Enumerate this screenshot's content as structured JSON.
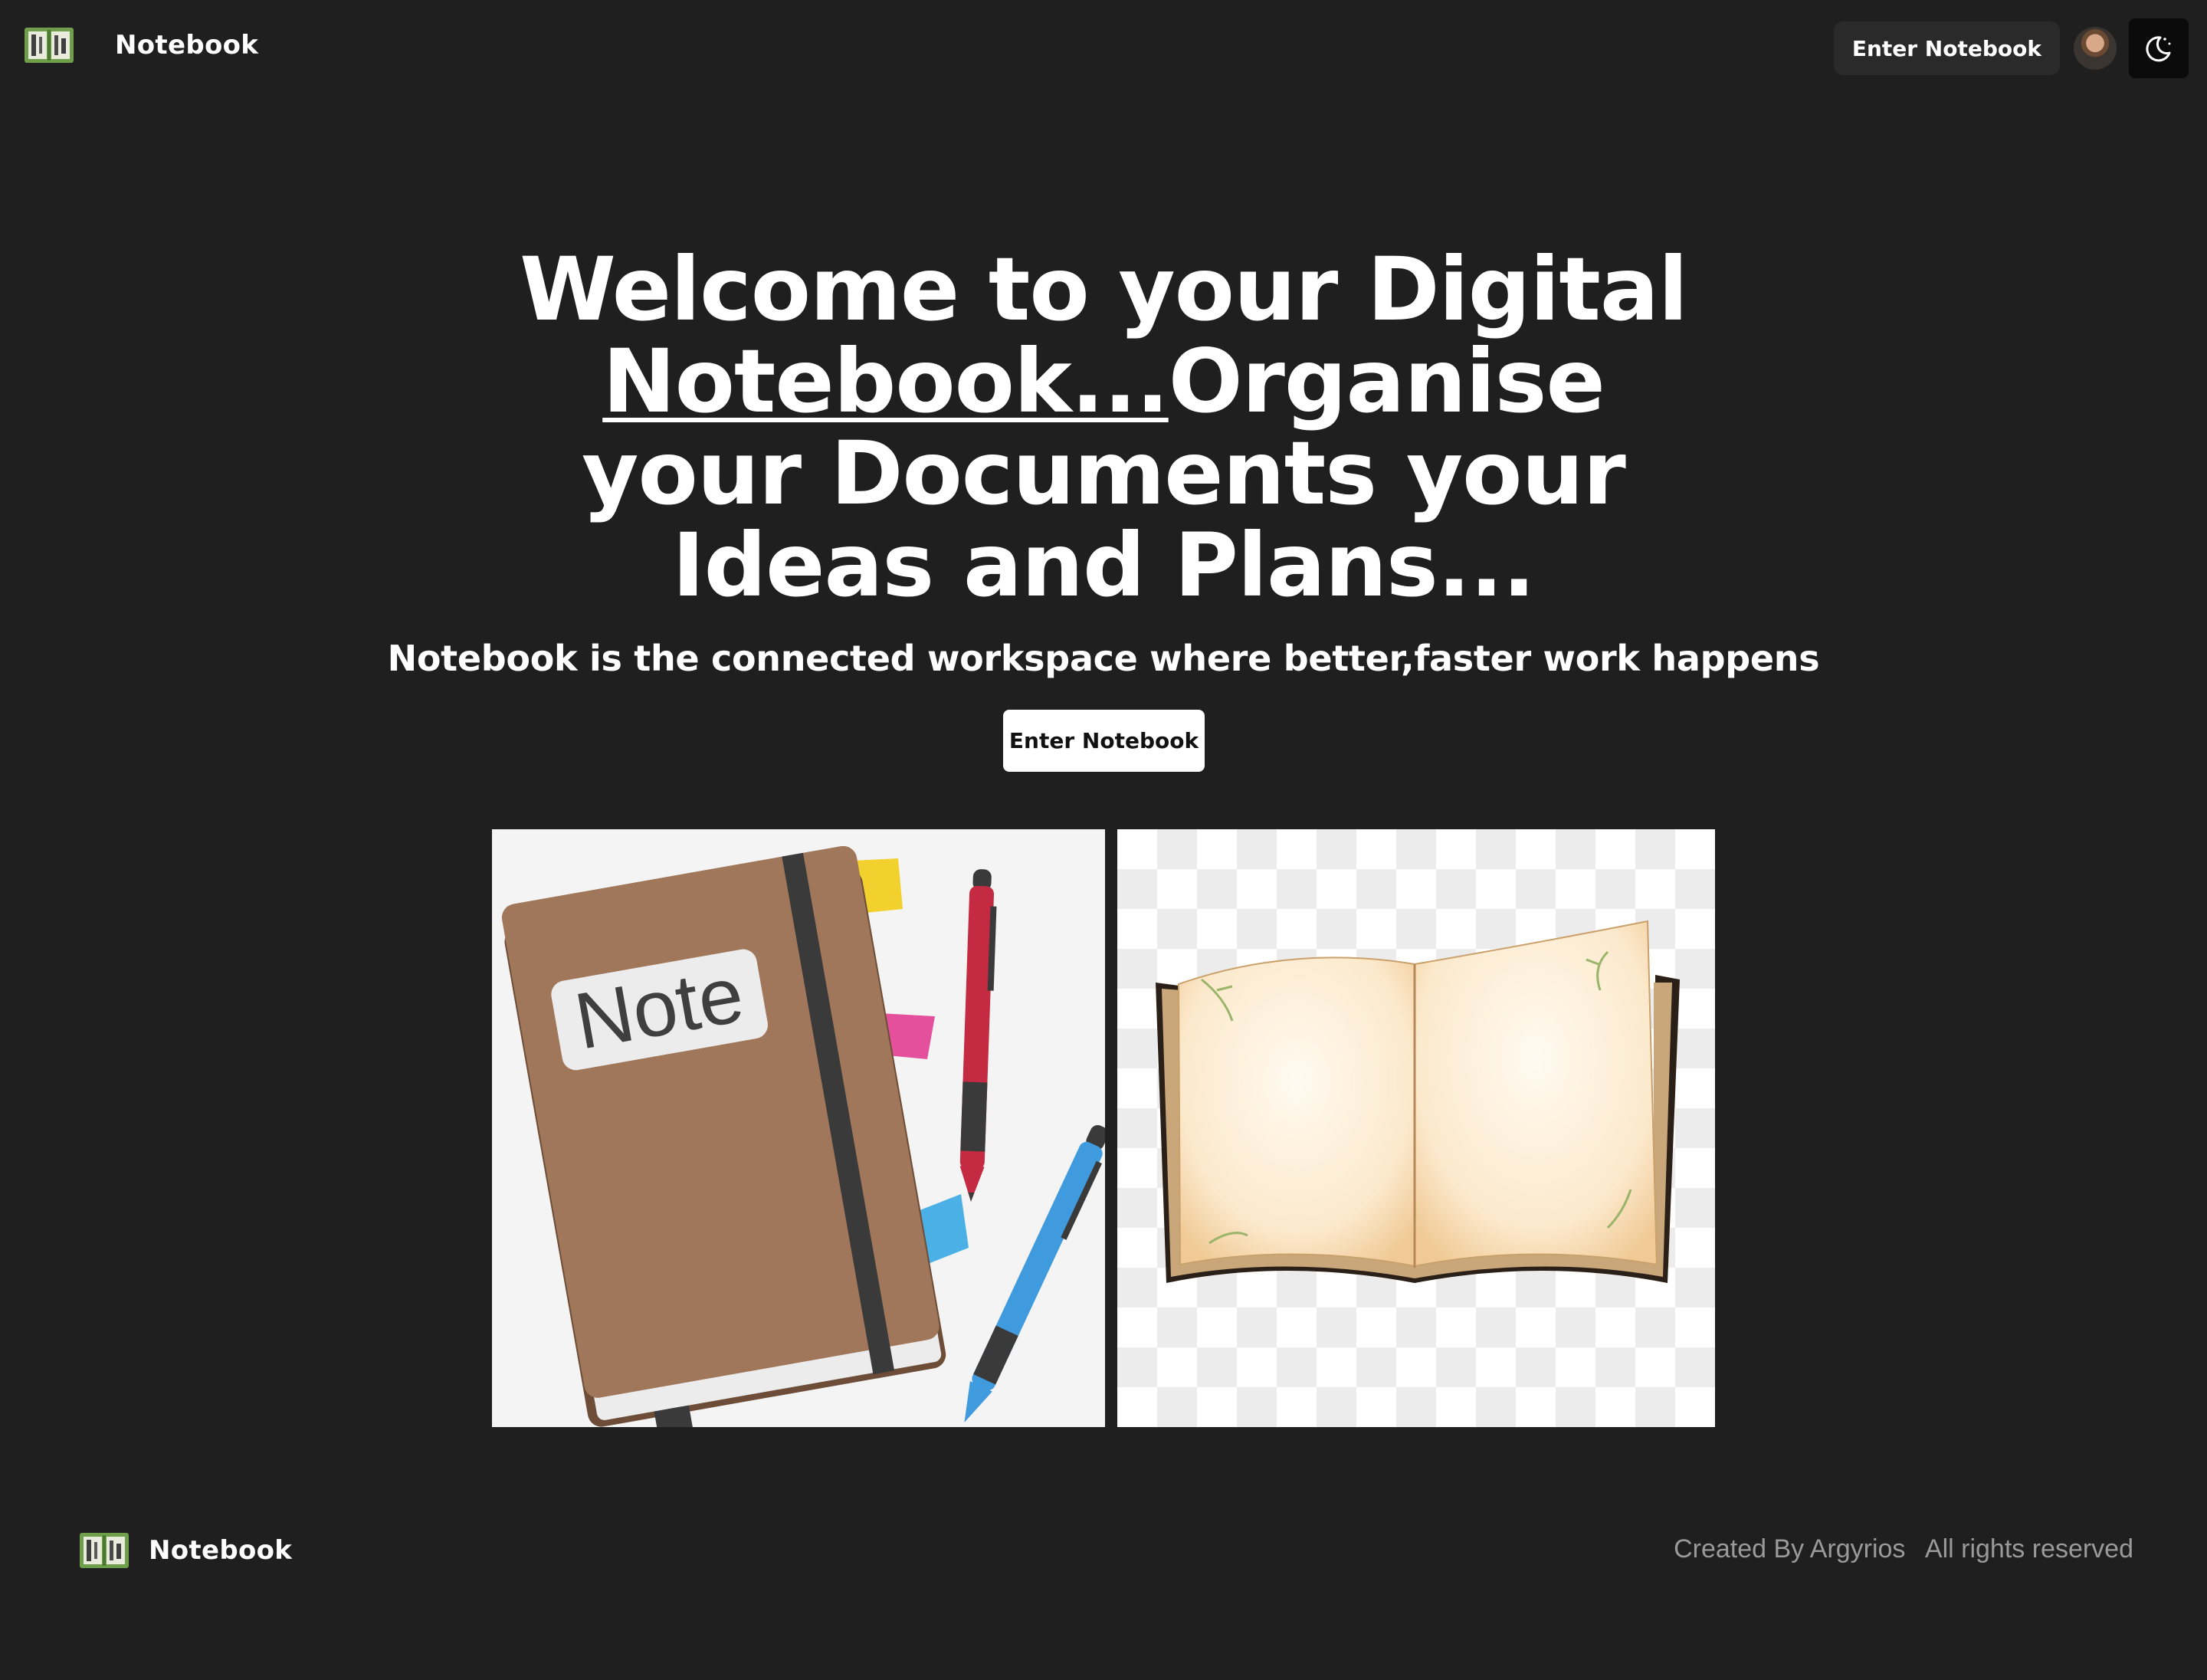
{
  "header": {
    "brand_name": "Notebook",
    "logo_icon": "notebook-logo-icon",
    "enter_button_label": "Enter Notebook",
    "avatar_icon": "user-avatar",
    "theme_toggle_icon": "moon-icon"
  },
  "hero": {
    "title_part1": "Welcome to your Digital ",
    "title_underlined": "Notebook...",
    "title_part2": "Organise your Documents your Ideas and Plans...",
    "subtitle": "Notebook is the connected workspace where better,faster work happens",
    "cta_label": "Enter Notebook"
  },
  "images": {
    "left_label": "Note",
    "left_icon": "notebook-with-pens-illustration",
    "right_icon": "open-book-illustration"
  },
  "footer": {
    "brand_name": "Notebook",
    "credit": "Created By Argyrios",
    "rights": "All rights reserved"
  },
  "colors": {
    "background": "#1f1f1f",
    "text": "#ffffff",
    "muted_text": "#9a9a9a",
    "logo_green": "#6f9f4a",
    "notebook_brown": "#a0775a"
  }
}
